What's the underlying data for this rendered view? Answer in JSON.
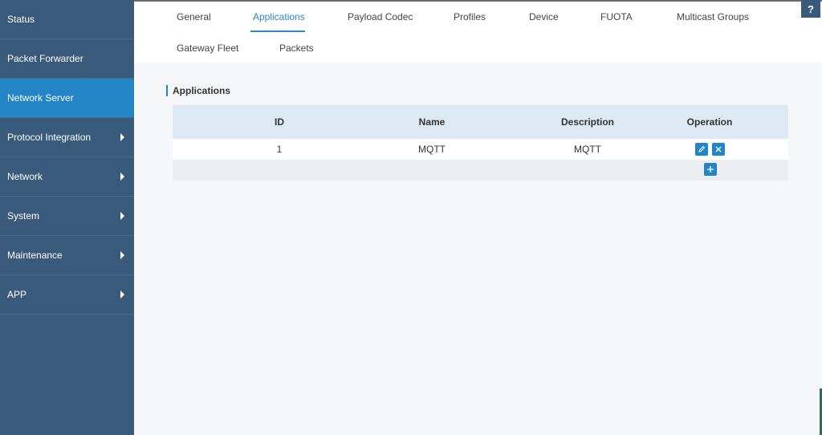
{
  "sidebar": {
    "items": [
      {
        "label": "Status",
        "active": false,
        "has_arrow": false
      },
      {
        "label": "Packet Forwarder",
        "active": false,
        "has_arrow": false
      },
      {
        "label": "Network Server",
        "active": true,
        "has_arrow": false
      },
      {
        "label": "Protocol Integration",
        "active": false,
        "has_arrow": true
      },
      {
        "label": "Network",
        "active": false,
        "has_arrow": true
      },
      {
        "label": "System",
        "active": false,
        "has_arrow": true
      },
      {
        "label": "Maintenance",
        "active": false,
        "has_arrow": true
      },
      {
        "label": "APP",
        "active": false,
        "has_arrow": true
      }
    ]
  },
  "tabs": {
    "items": [
      {
        "label": "General"
      },
      {
        "label": "Applications"
      },
      {
        "label": "Payload Codec"
      },
      {
        "label": "Profiles"
      },
      {
        "label": "Device"
      },
      {
        "label": "FUOTA"
      },
      {
        "label": "Multicast Groups"
      },
      {
        "label": "Gateway Fleet"
      },
      {
        "label": "Packets"
      }
    ],
    "active": "Applications"
  },
  "help": {
    "label": "?"
  },
  "section": {
    "title": "Applications"
  },
  "table": {
    "columns": [
      "ID",
      "Name",
      "Description",
      "Operation"
    ],
    "rows": [
      {
        "id": "1",
        "name": "MQTT",
        "description": "MQTT"
      }
    ]
  },
  "icons": {
    "edit": "pencil-icon",
    "delete": "close-icon",
    "add": "plus-icon",
    "arrow": "chevron-right-icon"
  },
  "colors": {
    "sidebar_bg": "#3a5a7c",
    "sidebar_active": "#2385c6",
    "accent": "#2d86c8",
    "table_header": "#dde9f4"
  }
}
